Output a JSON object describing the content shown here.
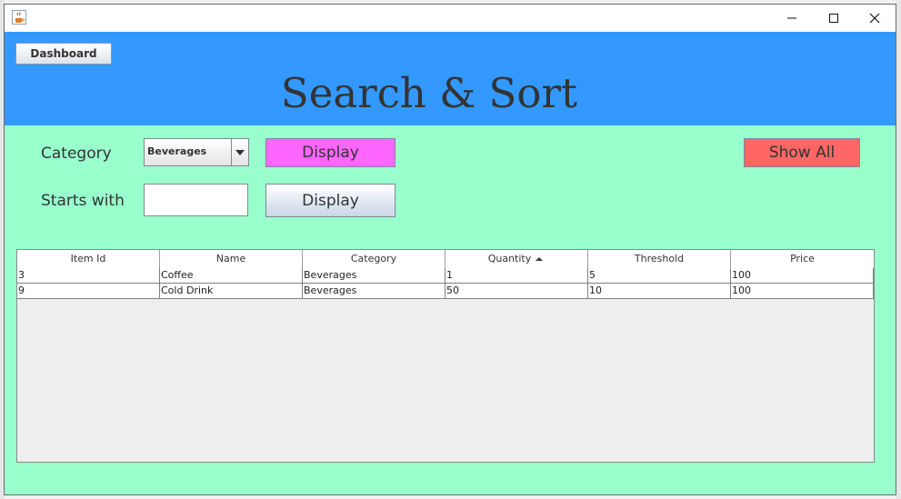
{
  "window": {
    "icon": "java-cup-icon",
    "controls": [
      "minimize-icon",
      "maximize-icon",
      "close-icon"
    ]
  },
  "header": {
    "dashboard_label": "Dashboard",
    "title": "Search & Sort",
    "color": "#3399ff"
  },
  "filters": {
    "category_label": "Category",
    "category_selected": "Beverages",
    "display_category_label": "Display",
    "show_all_label": "Show All",
    "starts_with_label": "Starts with",
    "starts_with_value": "",
    "display_starts_label": "Display"
  },
  "colors": {
    "background": "#99ffcc",
    "display_highlight": "#ff66ff",
    "show_all": "#ff6666"
  },
  "table": {
    "columns": [
      "Item Id",
      "Name",
      "Category",
      "Quantity",
      "Threshold",
      "Price"
    ],
    "sorted_column": "Quantity",
    "sort_direction": "ascending",
    "rows": [
      [
        "3",
        "Coffee",
        "Beverages",
        "1",
        "5",
        "100"
      ],
      [
        "9",
        "Cold Drink",
        "Beverages",
        "50",
        "10",
        "100"
      ]
    ]
  }
}
